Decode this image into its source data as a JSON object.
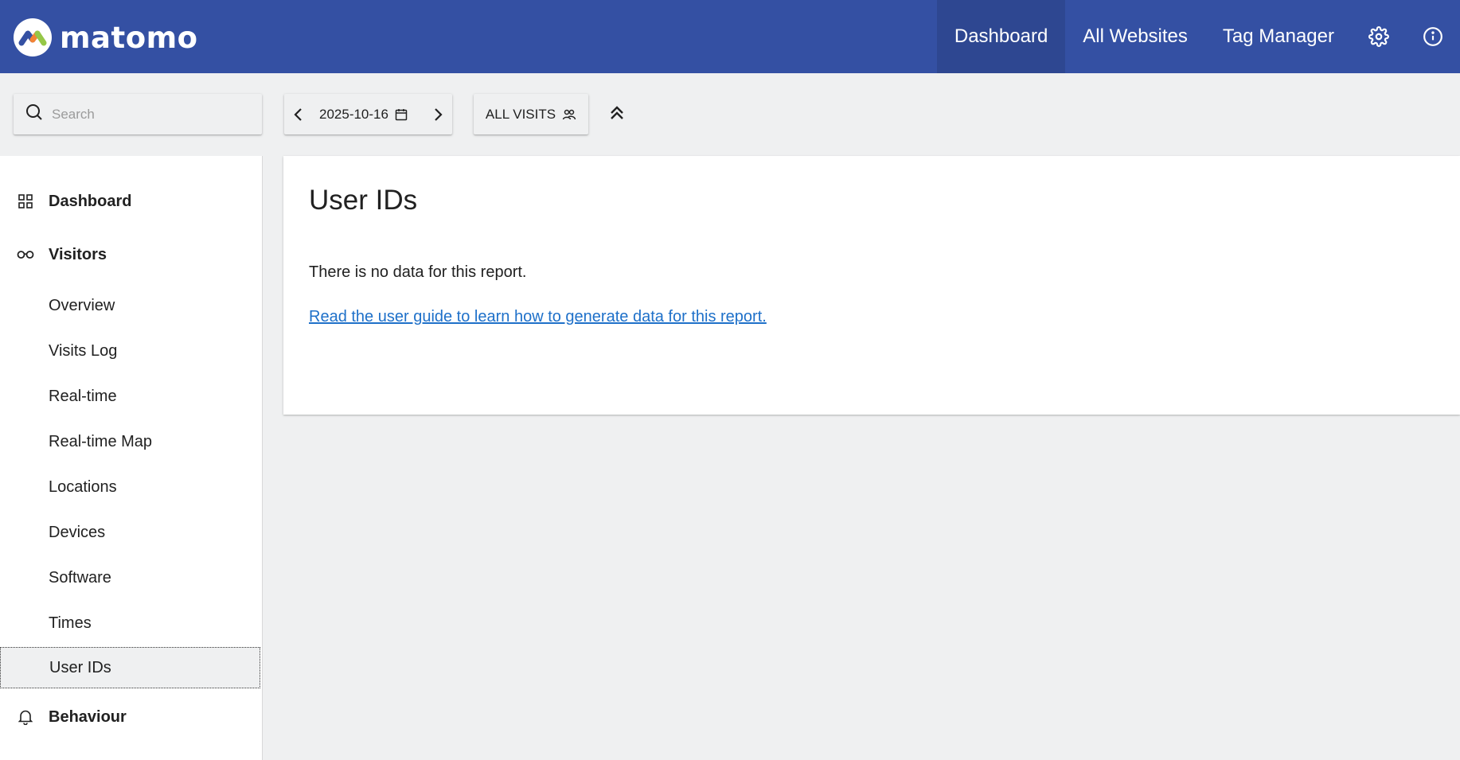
{
  "header": {
    "logo_text": "matomo",
    "nav": [
      {
        "label": "Dashboard",
        "active": true
      },
      {
        "label": "All Websites",
        "active": false
      },
      {
        "label": "Tag Manager",
        "active": false
      }
    ],
    "icons": [
      "gear-icon",
      "info-icon"
    ],
    "brand_color": "#3450a3"
  },
  "controls": {
    "search_placeholder": "Search",
    "date": "2025-10-16",
    "segment_label": "ALL VISITS"
  },
  "sidebar": {
    "categories": [
      {
        "label": "Dashboard",
        "icon": "grid-icon"
      },
      {
        "label": "Visitors",
        "icon": "glasses-icon"
      },
      {
        "label": "Behaviour",
        "icon": "bell-icon"
      }
    ],
    "visitors_items": [
      {
        "label": "Overview"
      },
      {
        "label": "Visits Log"
      },
      {
        "label": "Real-time"
      },
      {
        "label": "Real-time Map"
      },
      {
        "label": "Locations"
      },
      {
        "label": "Devices"
      },
      {
        "label": "Software"
      },
      {
        "label": "Times"
      },
      {
        "label": "User IDs",
        "active": true
      }
    ]
  },
  "report": {
    "title": "User IDs",
    "message": "There is no data for this report.",
    "link_text": "Read the user guide to learn how to generate data for this report."
  }
}
